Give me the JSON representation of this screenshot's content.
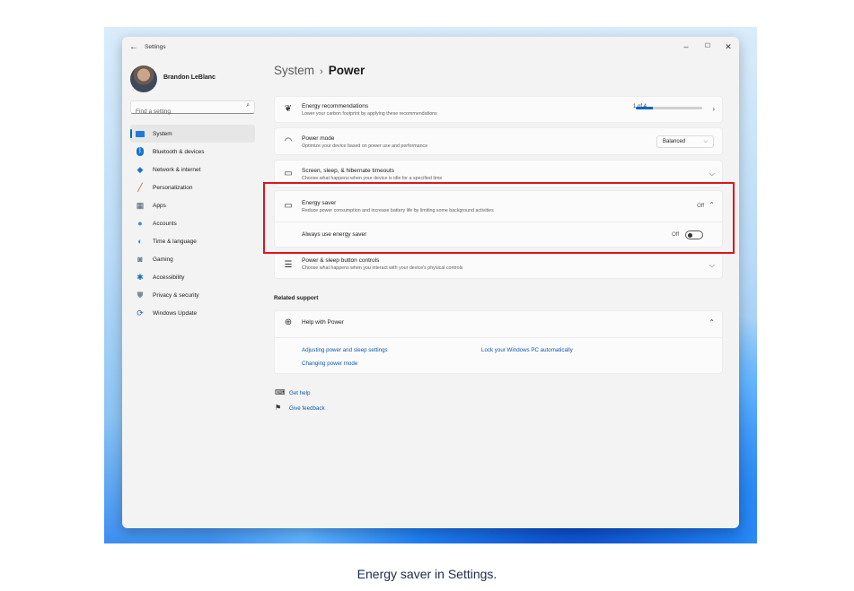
{
  "window": {
    "app_title": "Settings",
    "back_glyph": "←",
    "minimize_glyph": "–",
    "maximize_glyph": "☐",
    "close_glyph": "✕"
  },
  "user": {
    "name": "Brandon LeBlanc"
  },
  "search": {
    "placeholder": "Find a setting",
    "icon": "search-icon"
  },
  "sidebar": {
    "items": [
      {
        "label": "System",
        "icon": "system-icon",
        "active": true
      },
      {
        "label": "Bluetooth & devices",
        "icon": "bluetooth-icon"
      },
      {
        "label": "Network & internet",
        "icon": "wifi-icon"
      },
      {
        "label": "Personalization",
        "icon": "brush-icon"
      },
      {
        "label": "Apps",
        "icon": "apps-icon"
      },
      {
        "label": "Accounts",
        "icon": "accounts-icon"
      },
      {
        "label": "Time & language",
        "icon": "globe-clock-icon"
      },
      {
        "label": "Gaming",
        "icon": "gamepad-icon"
      },
      {
        "label": "Accessibility",
        "icon": "accessibility-icon"
      },
      {
        "label": "Privacy & security",
        "icon": "shield-icon"
      },
      {
        "label": "Windows Update",
        "icon": "update-icon"
      }
    ]
  },
  "breadcrumb": {
    "parent": "System",
    "separator": "›",
    "current": "Power"
  },
  "cards": {
    "energy_recommendations": {
      "title": "Energy recommendations",
      "desc": "Lower your carbon footprint by applying these recommendations",
      "pager": "1 of 4",
      "progress_fraction": 0.25,
      "icon": "leaf-icon"
    },
    "power_mode": {
      "title": "Power mode",
      "desc": "Optimize your device based on power use and performance",
      "value": "Balanced",
      "icon": "gauge-icon"
    },
    "screen_sleep": {
      "title": "Screen, sleep, & hibernate timeouts",
      "desc": "Choose what happens when your device is idle for a specified time",
      "icon": "monitor-sleep-icon"
    },
    "energy_saver": {
      "title": "Energy saver",
      "desc": "Reduce power consumption and increase battery life by limiting some background activities",
      "status": "Off",
      "icon": "battery-leaf-icon",
      "always_label": "Always use energy saver",
      "always_status": "Off",
      "always_on": false
    },
    "power_buttons": {
      "title": "Power & sleep button controls",
      "desc": "Choose what happens when you interact with your device's physical controls",
      "icon": "power-buttons-icon"
    }
  },
  "related_support": {
    "heading": "Related support",
    "help_title": "Help with Power",
    "links": [
      "Adjusting power and sleep settings",
      "Lock your Windows PC automatically",
      "Changing power mode"
    ]
  },
  "footer": {
    "get_help": "Get help",
    "give_feedback": "Give feedback"
  },
  "caption": "Energy saver in Settings.",
  "colors": {
    "accent": "#0067c0",
    "highlight": "#e0141c",
    "link": "#0b5cad"
  }
}
